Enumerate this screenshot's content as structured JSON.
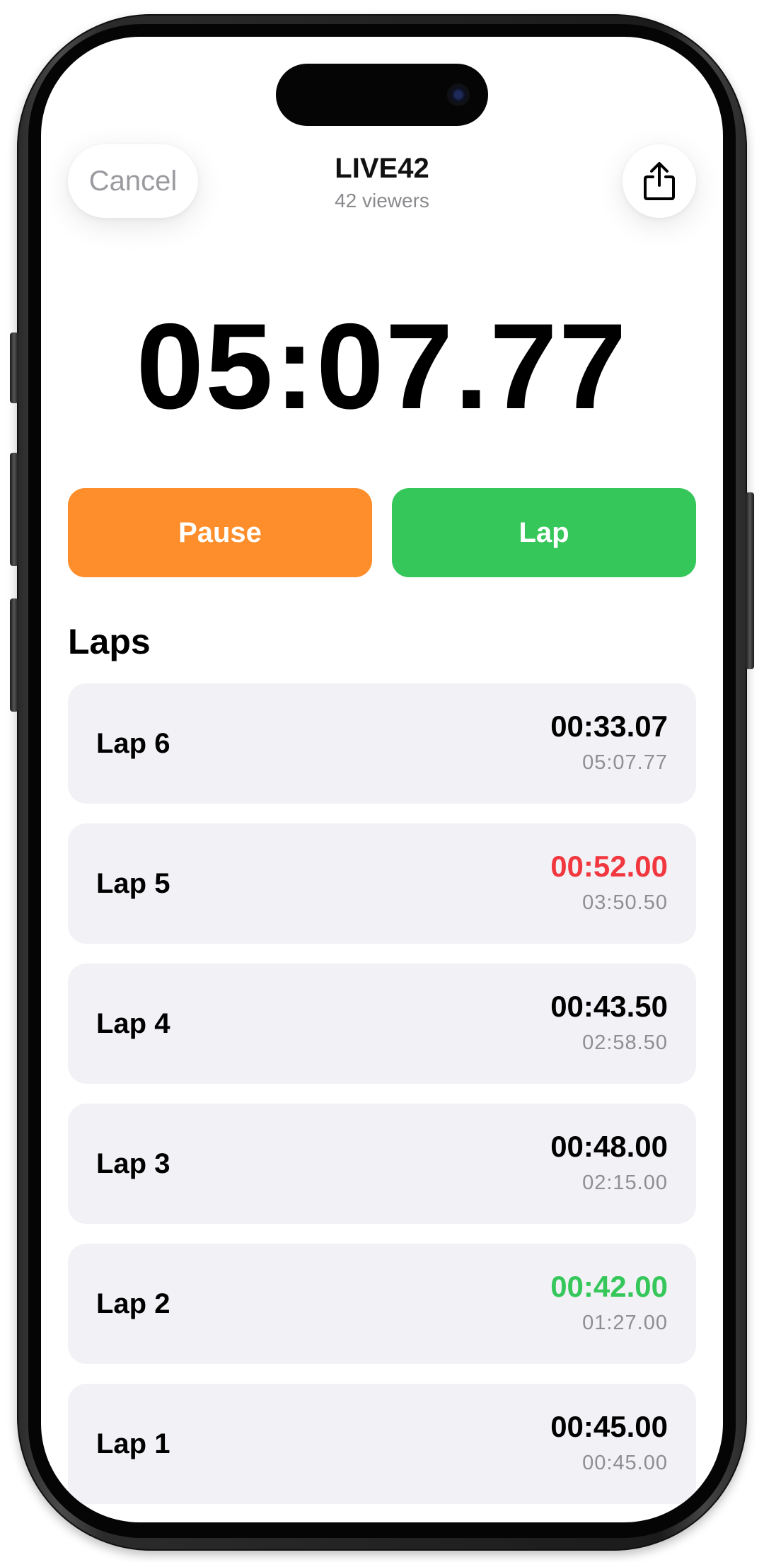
{
  "header": {
    "cancel_label": "Cancel",
    "title": "LIVE42",
    "viewers": "42 viewers",
    "share_icon": "share-icon"
  },
  "timer": {
    "elapsed": "05:07.77"
  },
  "controls": {
    "pause_label": "Pause",
    "lap_label": "Lap",
    "pause_color": "#fd8e2b",
    "lap_color": "#36c75a"
  },
  "laps": {
    "heading": "Laps",
    "slowest_color": "#f2383f",
    "fastest_color": "#36c75a",
    "items": [
      {
        "name": "Lap 6",
        "lap_time": "00:33.07",
        "total": "05:07.77",
        "status": "normal"
      },
      {
        "name": "Lap 5",
        "lap_time": "00:52.00",
        "total": "03:50.50",
        "status": "slowest"
      },
      {
        "name": "Lap 4",
        "lap_time": "00:43.50",
        "total": "02:58.50",
        "status": "normal"
      },
      {
        "name": "Lap 3",
        "lap_time": "00:48.00",
        "total": "02:15.00",
        "status": "normal"
      },
      {
        "name": "Lap 2",
        "lap_time": "00:42.00",
        "total": "01:27.00",
        "status": "fastest"
      },
      {
        "name": "Lap 1",
        "lap_time": "00:45.00",
        "total": "00:45.00",
        "status": "normal"
      }
    ]
  }
}
